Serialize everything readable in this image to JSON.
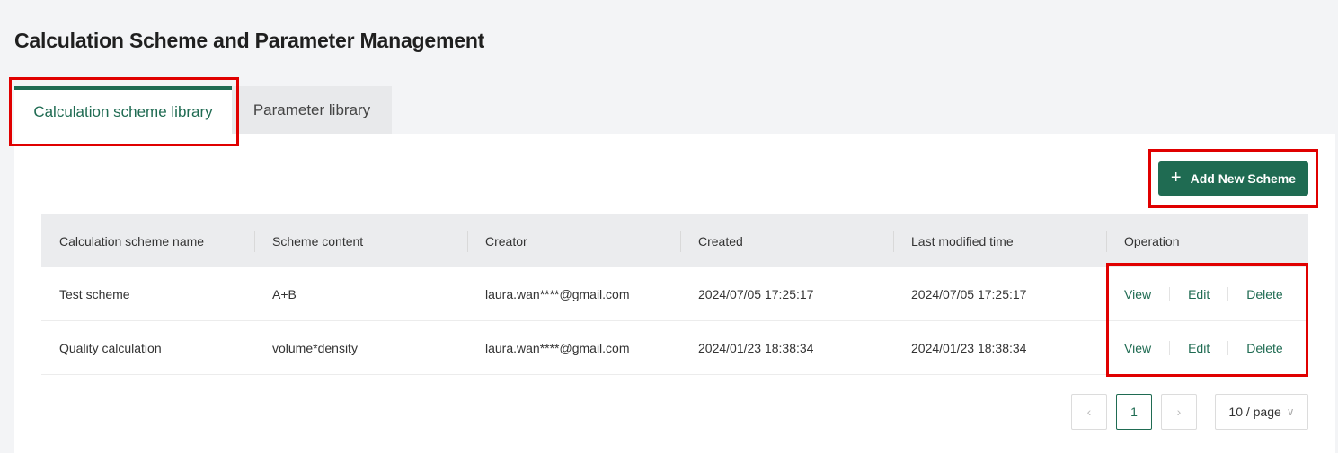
{
  "page": {
    "title": "Calculation Scheme and Parameter Management"
  },
  "tabs": [
    {
      "label": "Calculation scheme library",
      "active": true
    },
    {
      "label": "Parameter library",
      "active": false
    }
  ],
  "toolbar": {
    "add_label": "Add New Scheme",
    "add_icon": "plus-icon"
  },
  "table": {
    "columns": [
      "Calculation scheme name",
      "Scheme content",
      "Creator",
      "Created",
      "Last modified time",
      "Operation"
    ],
    "rows": [
      {
        "name": "Test scheme",
        "content": "A+B",
        "creator": "laura.wan****@gmail.com",
        "created": "2024/07/05 17:25:17",
        "modified": "2024/07/05 17:25:17"
      },
      {
        "name": "Quality calculation",
        "content": "volume*density",
        "creator": "laura.wan****@gmail.com",
        "created": "2024/01/23 18:38:34",
        "modified": "2024/01/23 18:38:34"
      }
    ],
    "operations": {
      "view": "View",
      "edit": "Edit",
      "delete": "Delete"
    }
  },
  "pagination": {
    "current_page": "1",
    "page_size": "10 / page"
  },
  "colors": {
    "accent": "#1f6b52",
    "highlight": "#e00000"
  }
}
